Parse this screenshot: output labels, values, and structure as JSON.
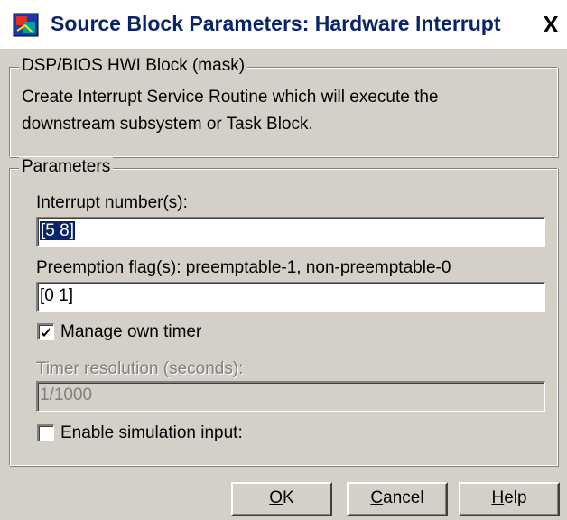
{
  "window": {
    "title": "Source Block Parameters: Hardware Interrupt",
    "close_label": "X"
  },
  "mask": {
    "legend": "DSP/BIOS HWI Block (mask)",
    "description": "Create Interrupt Service Routine which will execute the downstream subsystem or Task Block."
  },
  "params": {
    "legend": "Parameters",
    "interrupt_label": "Interrupt number(s):",
    "interrupt_value": "[5 8]",
    "preemption_label": "Preemption flag(s): preemptable-1, non-preemptable-0",
    "preemption_value": "[0 1]",
    "manage_timer_label": "Manage own timer",
    "manage_timer_checked": true,
    "timer_res_label": "Timer resolution (seconds):",
    "timer_res_value": "1/1000",
    "enable_sim_label": "Enable simulation input:",
    "enable_sim_checked": false
  },
  "buttons": {
    "ok": {
      "mnemonic": "O",
      "rest": "K"
    },
    "cancel": {
      "mnemonic": "C",
      "rest": "ancel"
    },
    "help": {
      "mnemonic": "H",
      "rest": "elp"
    }
  }
}
